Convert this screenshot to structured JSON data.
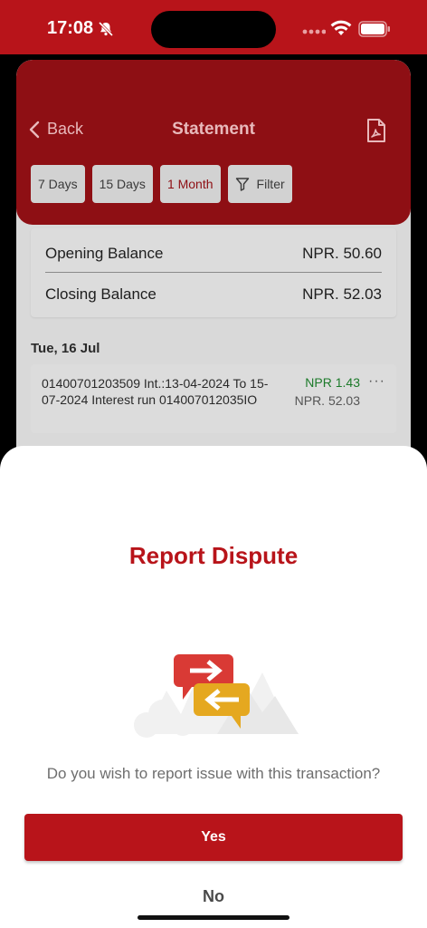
{
  "status_bar": {
    "time": "17:08",
    "icons": [
      "bell-slash-icon",
      "signal-dots-icon",
      "wifi-icon",
      "battery-icon"
    ]
  },
  "header": {
    "back_label": "Back",
    "title": "Statement",
    "pdf_icon": "pdf-icon",
    "color": "#b8141a"
  },
  "filters": {
    "chips": [
      {
        "label": "7 Days",
        "active": false
      },
      {
        "label": "15 Days",
        "active": false
      },
      {
        "label": "1 Month",
        "active": true
      }
    ],
    "filter_label": "Filter"
  },
  "balance": {
    "opening_label": "Opening Balance",
    "opening_value": "NPR. 50.60",
    "closing_label": "Closing Balance",
    "closing_value": "NPR. 52.03"
  },
  "transactions": {
    "date": "Tue, 16 Jul",
    "items": [
      {
        "description": "01400701203509 Int.:13-04-2024 To 15-07-2024 Interest run 014007012035IO",
        "amount": "NPR 1.43",
        "balance": "NPR. 52.03",
        "more": "···"
      }
    ]
  },
  "dispute_modal": {
    "title": "Report Dispute",
    "question": "Do you wish to report issue with this transaction?",
    "yes_label": "Yes",
    "no_label": "No",
    "accent_color": "#b8141a"
  }
}
